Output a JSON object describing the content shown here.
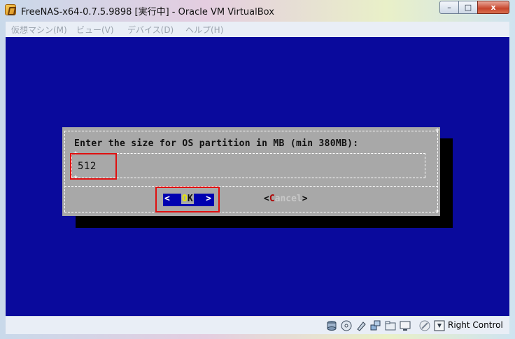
{
  "window": {
    "title": "FreeNAS-x64-0.7.5.9898 [実行中] - Oracle VM VirtualBox",
    "controls": {
      "minimize": "–",
      "maximize": "□",
      "close": "x"
    }
  },
  "menu": [
    {
      "label": "仮想マシン(M)"
    },
    {
      "label": "ビュー(V)"
    },
    {
      "label": "デバイス(D)"
    },
    {
      "label": "ヘルプ(H)"
    }
  ],
  "dialog": {
    "prompt": "Enter the size for OS partition in MB (min 380MB):",
    "input_value": "512",
    "ok": {
      "left": "<",
      "hotkey": "O",
      "rest": "K",
      "right": ">"
    },
    "cancel": {
      "open": "<",
      "hotkey": "C",
      "rest": "ancel",
      "close": ">"
    }
  },
  "colors": {
    "vm_background": "#0a0a9c",
    "dialog_background": "#a8a8a8",
    "highlight_box": "#e01010"
  },
  "statusbar": {
    "icons": [
      "hard-disk-icon",
      "cd-icon",
      "usb-icon",
      "network-icon",
      "shared-folder-icon",
      "display-icon",
      "mouse-integration-icon",
      "keyboard-capture-icon"
    ],
    "host_key_label": "Right Control"
  }
}
